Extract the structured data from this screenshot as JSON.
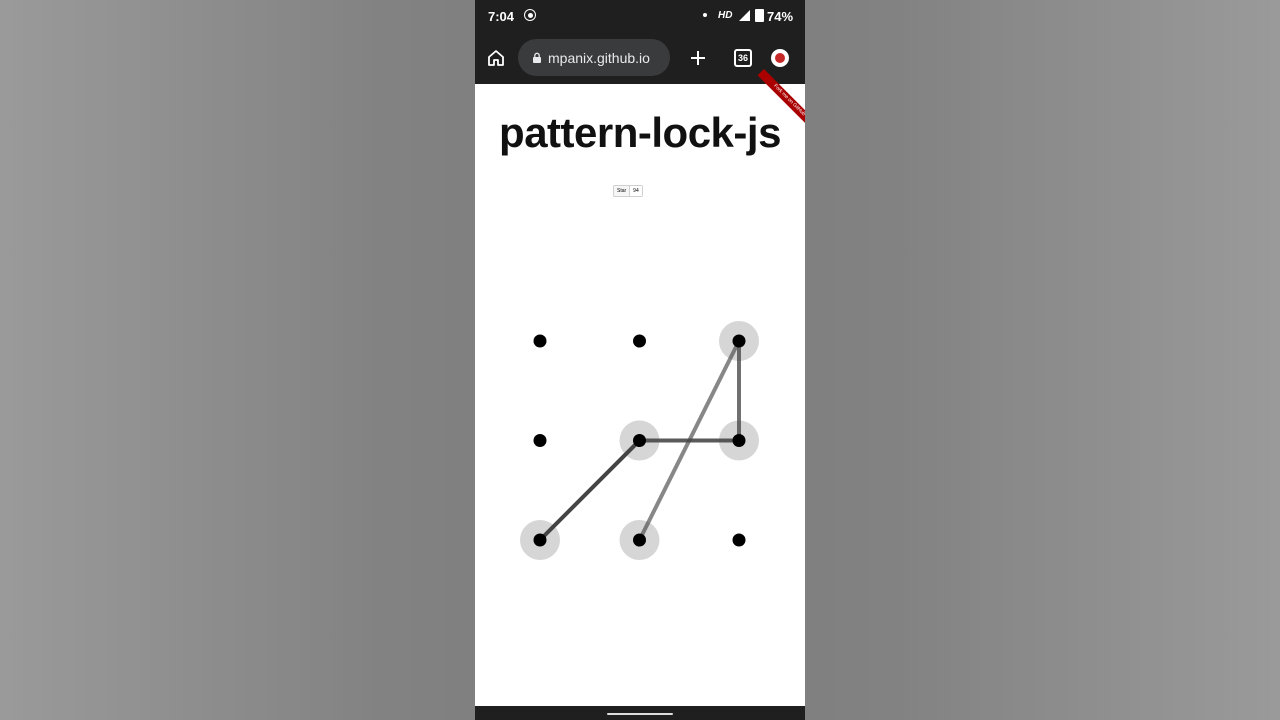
{
  "status_bar": {
    "time": "7:04",
    "network": "HD",
    "battery": "74%"
  },
  "browser": {
    "url": "mpanix.github.io",
    "tab_count": "36"
  },
  "page": {
    "title": "pattern-lock-js",
    "ribbon": "Fork me on GitHub",
    "star_label": "Star",
    "star_count": "94"
  },
  "pattern": {
    "grid": [
      3,
      3
    ],
    "sequence": [
      7,
      5,
      6,
      3,
      8
    ],
    "dot_color": "#000000",
    "selected_halo_color": "#d6d6d6",
    "line_color": "#444444"
  }
}
